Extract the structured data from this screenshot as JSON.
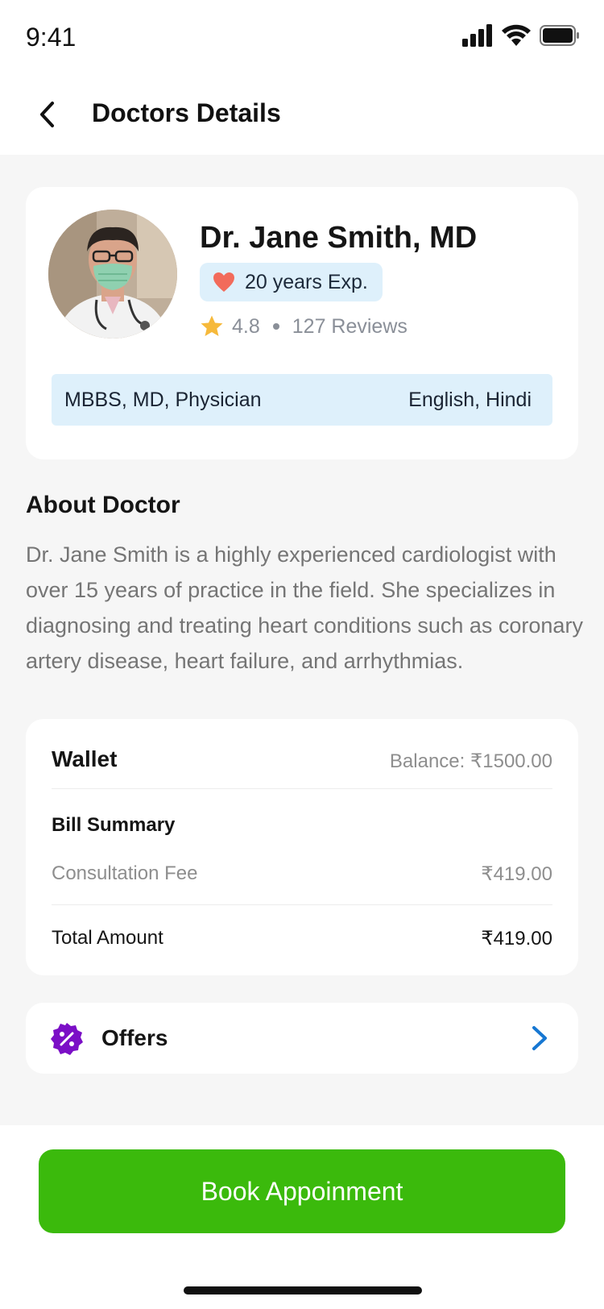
{
  "status_bar": {
    "time": "9:41",
    "icons": [
      "signal-icon",
      "wifi-icon",
      "battery-icon"
    ]
  },
  "header": {
    "title": "Doctors Details",
    "back_icon": "chevron-left-icon"
  },
  "doctor": {
    "name": "Dr. Jane Smith, MD",
    "experience": "20 years Exp.",
    "rating": "4.8",
    "reviews": "127 Reviews",
    "qualifications": "MBBS, MD, Physician",
    "languages": "English, Hindi"
  },
  "about": {
    "title": "About Doctor",
    "text": "Dr. Jane Smith is a highly experienced cardiologist with over 15 years of practice in the field. She specializes in diagnosing and treating heart conditions such as coronary artery disease, heart failure, and arrhythmias."
  },
  "wallet": {
    "title": "Wallet",
    "balance": "Balance:  ₹1500.00",
    "bill_title": "Bill Summary",
    "fee_label": "Consultation Fee",
    "fee_value": "₹419.00",
    "total_label": "Total Amount",
    "total_value": "₹419.00"
  },
  "offers": {
    "label": "Offers"
  },
  "cta": {
    "label": "Book Appoinment"
  },
  "colors": {
    "accent_green": "#3bba0c",
    "badge_blue": "#def0fb",
    "offers_purple": "#7b0fc6",
    "chevron_blue": "#1677d2",
    "heart_red": "#f26b5b",
    "star_yellow": "#f6b93b"
  }
}
